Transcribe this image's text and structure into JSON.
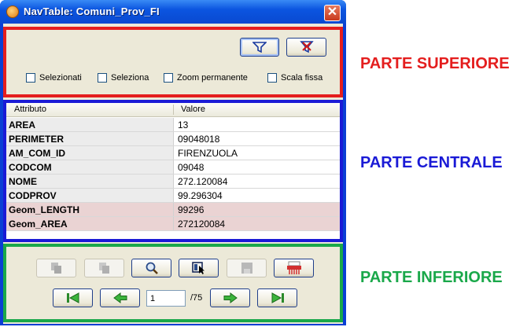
{
  "window": {
    "title": "NavTable: Comuni_Prov_FI",
    "close_glyph": "✕"
  },
  "top": {
    "checkboxes": [
      {
        "label": "Selezionati",
        "checked": false
      },
      {
        "label": "Seleziona",
        "checked": false
      },
      {
        "label": "Zoom permanente",
        "checked": false
      },
      {
        "label": "Scala fissa",
        "checked": false
      }
    ]
  },
  "table": {
    "headers": {
      "attribute": "Attributo",
      "value": "Valore"
    },
    "rows": [
      {
        "attr": "AREA",
        "value": "13"
      },
      {
        "attr": "PERIMETER",
        "value": "09048018"
      },
      {
        "attr": "AM_COM_ID",
        "value": "FIRENZUOLA"
      },
      {
        "attr": "CODCOM",
        "value": "09048"
      },
      {
        "attr": "NOME",
        "value": "272.120084"
      },
      {
        "attr": "CODPROV",
        "value": "99.296304"
      },
      {
        "attr": "Geom_LENGTH",
        "value": "99296"
      },
      {
        "attr": "Geom_AREA",
        "value": "272120084"
      }
    ]
  },
  "navigation": {
    "current_page": "1",
    "total_label": "/75"
  },
  "annotations": {
    "top": {
      "text": "PARTE SUPERIORE",
      "color": "#e41e1e"
    },
    "middle": {
      "text": "PARTE CENTRALE",
      "color": "#1a1ad6"
    },
    "bottom": {
      "text": "PARTE INFERIORE",
      "color": "#1aa84a"
    }
  }
}
